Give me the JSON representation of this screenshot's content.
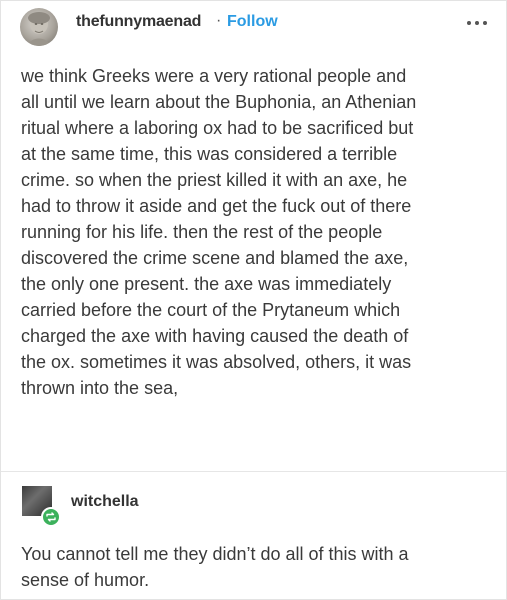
{
  "post": {
    "author": "thefunnymaenad",
    "separator": "·",
    "follow_label": "Follow",
    "body_lines": [
      "we think Greeks were a very rational people and",
      "all until we learn about the Buphonia, an Athenian",
      "ritual where a laboring ox had to be sacrificed but",
      "at the same time, this was considered a terrible",
      "crime. so when the priest killed it with an axe, he",
      "had to throw it aside and get the fuck out of there",
      "running for his life. then the rest of the people",
      "discovered the crime scene and blamed the axe,",
      "the only one present. the axe was immediately",
      "carried before the court of the Prytaneum which",
      "charged the axe with having caused the death of",
      "the ox. sometimes it was absolved, others, it was",
      "thrown into the sea,"
    ]
  },
  "reblog": {
    "author": "witchella",
    "body_lines": [
      "You cannot tell me they didn’t do all of this with a",
      "sense of humor."
    ]
  },
  "icons": {
    "avatar": "statue-avatar",
    "more": "more-options-icon",
    "reblog_badge": "reblog-icon"
  },
  "colors": {
    "follow": "#2b9be3",
    "reblog_badge": "#3cb15c",
    "text": "#3a3a3a"
  }
}
